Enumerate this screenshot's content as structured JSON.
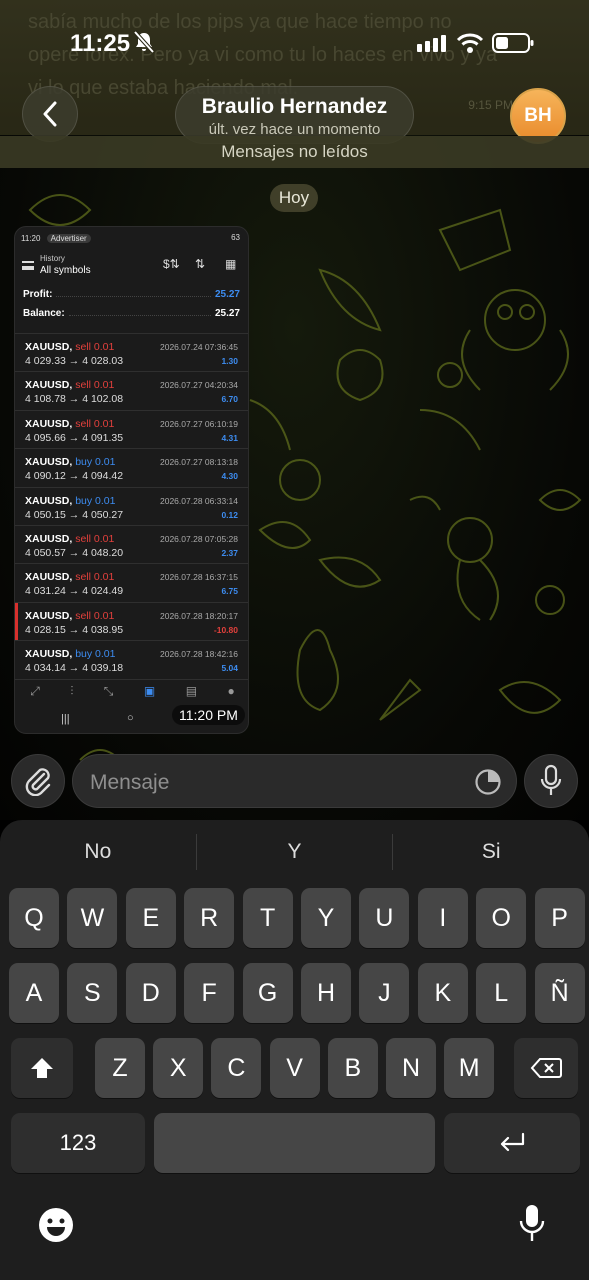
{
  "status_bar": {
    "time": "11:25"
  },
  "background_message": {
    "text": "sabía mucho de los pips ya que hace tiempo no operé forex. Pero ya vi como tu lo haces en vivo y ya vi lo que estaba haciendo mal.",
    "time": "9:15 PM"
  },
  "header": {
    "name": "Braulio Hernandez",
    "status": "últ. vez hace un momento",
    "avatar_initials": "BH",
    "avatar_color": "#f0a040"
  },
  "unread_label": "Mensajes no leídos",
  "date_chip": "Hoy",
  "photo_message": {
    "time": "11:20 PM",
    "screenshot": {
      "status_time": "11:20",
      "ad_label": "Advertiser",
      "battery": "63",
      "header_small": "History",
      "header_title": "All symbols",
      "profit_label": "Profit:",
      "profit_value": "25.27",
      "balance_label": "Balance:",
      "balance_value": "25.27",
      "deals": [
        {
          "symbol": "XAUUSD,",
          "side": "sell 0.01",
          "prices": "4 029.33 → 4 028.03",
          "date": "2026.07.24 07:36:45",
          "profit": "1.30",
          "loss": false
        },
        {
          "symbol": "XAUUSD,",
          "side": "sell 0.01",
          "prices": "4 108.78 → 4 102.08",
          "date": "2026.07.27 04:20:34",
          "profit": "6.70",
          "loss": false
        },
        {
          "symbol": "XAUUSD,",
          "side": "sell 0.01",
          "prices": "4 095.66 → 4 091.35",
          "date": "2026.07.27 06:10:19",
          "profit": "4.31",
          "loss": false
        },
        {
          "symbol": "XAUUSD,",
          "side": "buy 0.01",
          "prices": "4 090.12 → 4 094.42",
          "date": "2026.07.27 08:13:18",
          "profit": "4.30",
          "loss": false
        },
        {
          "symbol": "XAUUSD,",
          "side": "buy 0.01",
          "prices": "4 050.15 → 4 050.27",
          "date": "2026.07.28 06:33:14",
          "profit": "0.12",
          "loss": false
        },
        {
          "symbol": "XAUUSD,",
          "side": "sell 0.01",
          "prices": "4 050.57 → 4 048.20",
          "date": "2026.07.28 07:05:28",
          "profit": "2.37",
          "loss": false
        },
        {
          "symbol": "XAUUSD,",
          "side": "sell 0.01",
          "prices": "4 031.24 → 4 024.49",
          "date": "2026.07.28 16:37:15",
          "profit": "6.75",
          "loss": false
        },
        {
          "symbol": "XAUUSD,",
          "side": "sell 0.01",
          "prices": "4 028.15 → 4 038.95",
          "date": "2026.07.28 18:20:17",
          "profit": "-10.80",
          "loss": true
        },
        {
          "symbol": "XAUUSD,",
          "side": "buy 0.01",
          "prices": "4 034.14 → 4 039.18",
          "date": "2026.07.28 18:42:16",
          "profit": "5.04",
          "loss": false
        }
      ]
    }
  },
  "composer": {
    "placeholder": "Mensaje"
  },
  "keyboard": {
    "suggestions": [
      "No",
      "Y",
      "Si"
    ],
    "row1": [
      "Q",
      "W",
      "E",
      "R",
      "T",
      "Y",
      "U",
      "I",
      "O",
      "P"
    ],
    "row2": [
      "A",
      "S",
      "D",
      "F",
      "G",
      "H",
      "J",
      "K",
      "L",
      "Ñ"
    ],
    "row3": [
      "Z",
      "X",
      "C",
      "V",
      "B",
      "N",
      "M"
    ],
    "numbers_label": "123"
  },
  "colors": {
    "accent": "#3d8cf0",
    "loss": "#e2403c",
    "doodle": "#6b7a1e"
  }
}
